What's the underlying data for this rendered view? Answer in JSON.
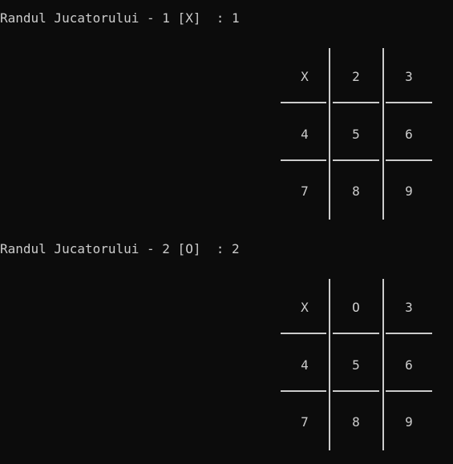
{
  "turns": [
    {
      "prompt": "Randul Jucatorului - 1 [X]  : 1",
      "board": [
        "X",
        "2",
        "3",
        "4",
        "5",
        "6",
        "7",
        "8",
        "9"
      ]
    },
    {
      "prompt": "Randul Jucatorului - 2 [O]  : 2",
      "board": [
        "X",
        "O",
        "3",
        "4",
        "5",
        "6",
        "7",
        "8",
        "9"
      ]
    }
  ],
  "colors": {
    "background": "#0c0c0c",
    "foreground": "#cccccc"
  }
}
